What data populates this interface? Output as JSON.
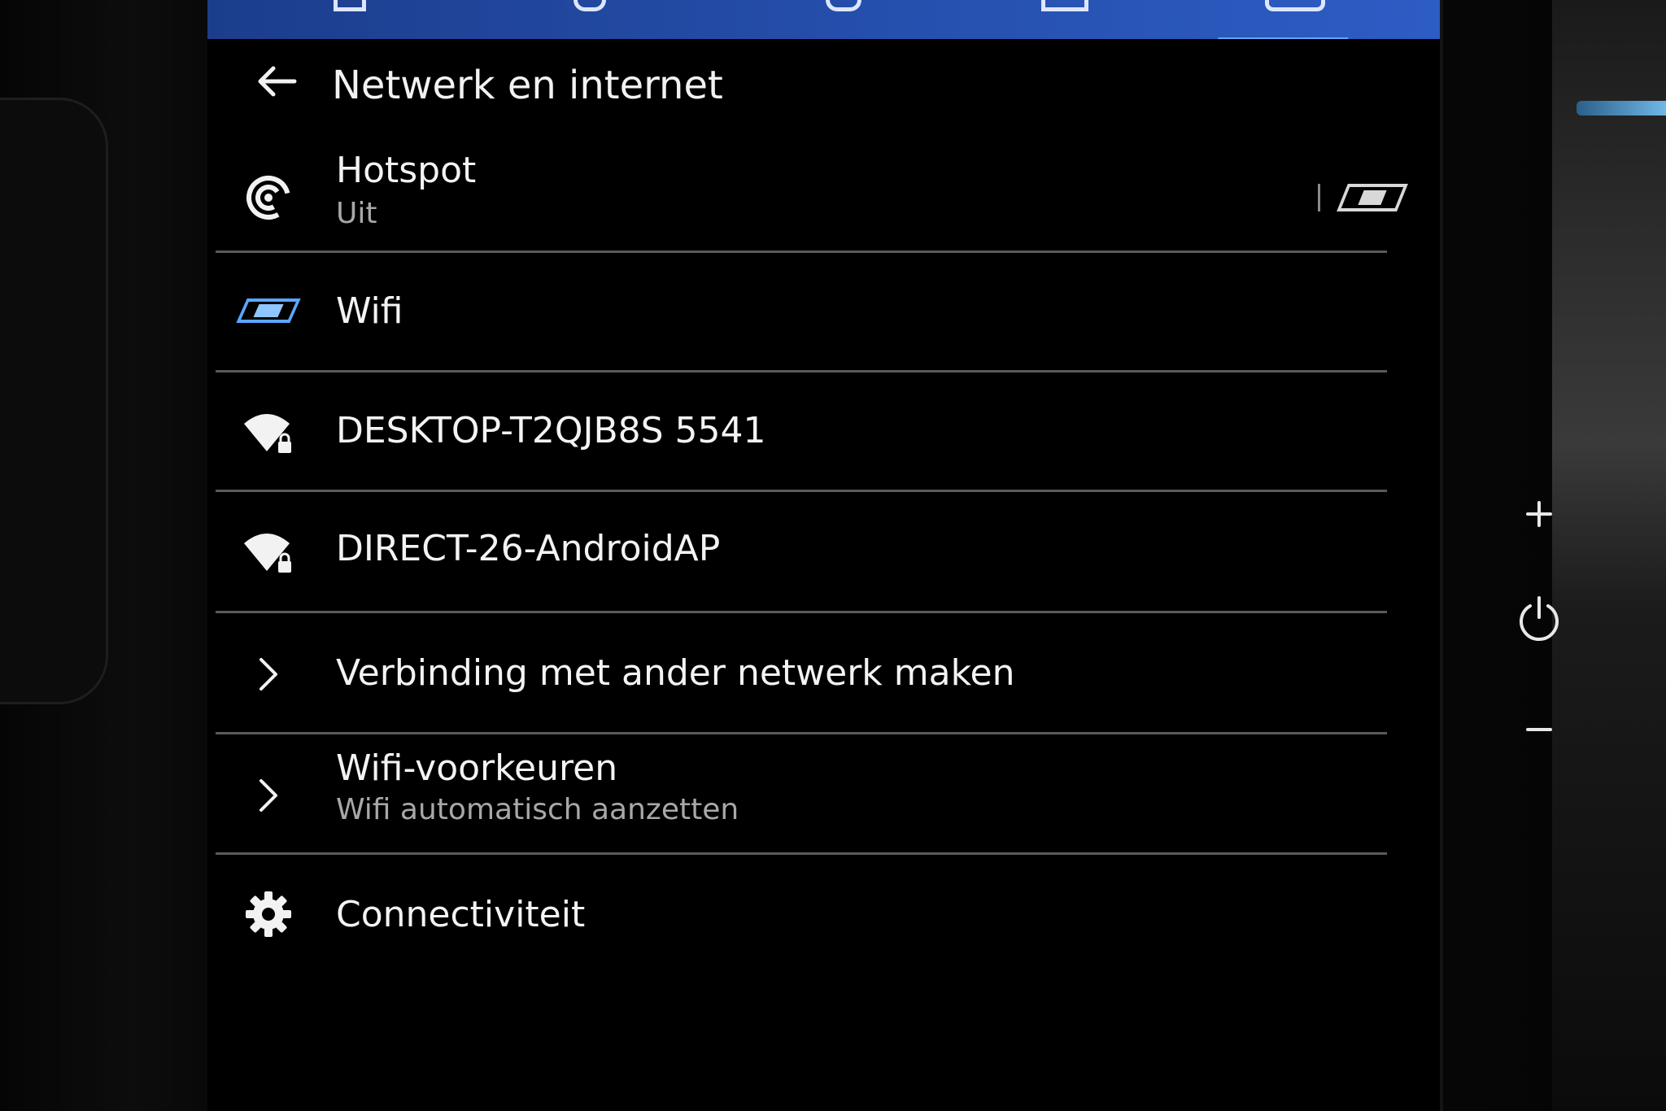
{
  "header": {
    "title": "Netwerk en internet"
  },
  "rows": {
    "hotspot": {
      "title": "Hotspot",
      "subtitle": "Uit",
      "toggle_state": "off"
    },
    "wifi": {
      "title": "Wifi",
      "toggle_state": "on"
    },
    "network_1": {
      "title": "DESKTOP-T2QJB8S 5541",
      "secured": true
    },
    "network_2": {
      "title": "DIRECT-26-AndroidAP",
      "secured": true
    },
    "connect_other": {
      "title": "Verbinding met ander netwerk maken"
    },
    "wifi_prefs": {
      "title": "Wifi-voorkeuren",
      "subtitle": "Wifi automatisch aanzetten"
    },
    "connectivity": {
      "title": "Connectiviteit"
    }
  },
  "icons": {
    "back": "arrow-left-icon",
    "hotspot": "hotspot-icon",
    "wifi": "wifi-toggle-icon",
    "network": "wifi-lock-icon",
    "chevron": "chevron-right-icon",
    "settings": "gear-icon",
    "volume_up": "plus-icon",
    "power": "power-icon",
    "volume_down": "minus-icon"
  },
  "colors": {
    "topbar": "#2651b0",
    "accent": "#5ba7ff",
    "text": "#f3f3f3",
    "subtext": "#a8a8a8",
    "divider": "#5a5a5a"
  }
}
